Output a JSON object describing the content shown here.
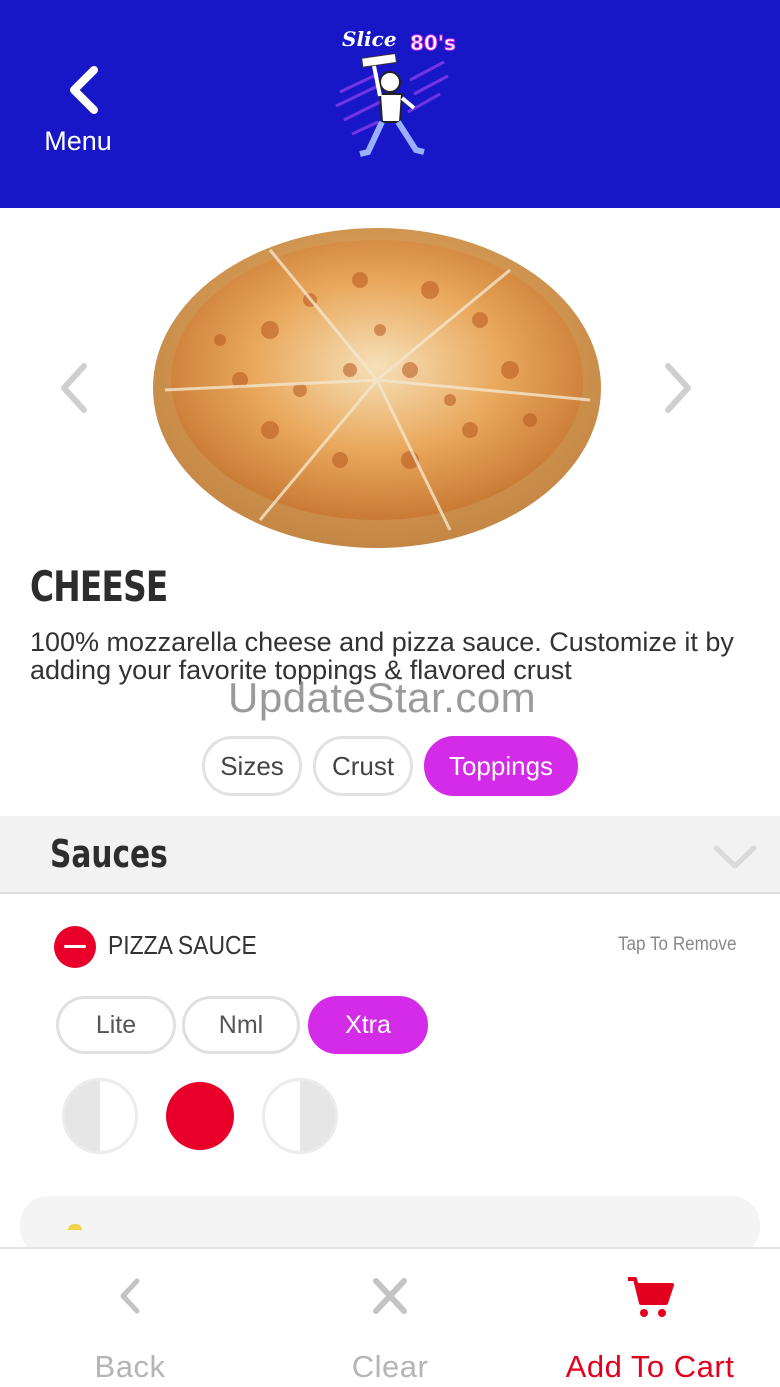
{
  "header": {
    "back_label": "Menu",
    "logo_text": "Slice of the 80's",
    "background_color": "#1717c8"
  },
  "product": {
    "title": "CHEESE",
    "description": "100% mozzarella cheese and pizza sauce. Customize it by adding your favorite toppings & flavored crust",
    "image_name": "cheese-pizza-image"
  },
  "watermark": "UpdateStar.com",
  "tabs": [
    {
      "label": "Sizes",
      "active": false
    },
    {
      "label": "Crust",
      "active": false
    },
    {
      "label": "Toppings",
      "active": true
    }
  ],
  "section": {
    "title": "Sauces",
    "icon": "chevron-down-icon"
  },
  "topping": {
    "name": "PIZZA SAUCE",
    "tap_to_remove": "Tap To Remove",
    "amounts": [
      {
        "label": "Lite",
        "active": false
      },
      {
        "label": "Nml",
        "active": false
      },
      {
        "label": "Xtra",
        "active": true
      }
    ],
    "placements": [
      "left-half",
      "whole",
      "right-half"
    ],
    "selected_placement": "whole"
  },
  "bottom_bar": {
    "back_label": "Back",
    "clear_label": "Clear",
    "cart_label": "Add To Cart"
  },
  "colors": {
    "accent": "#d42be8",
    "brand": "#1717c8",
    "red": "#e3001f"
  }
}
